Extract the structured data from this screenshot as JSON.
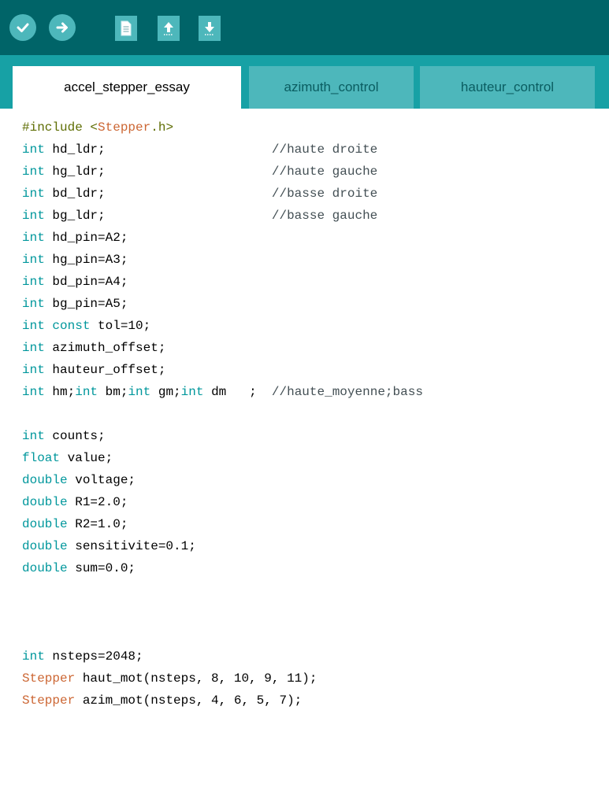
{
  "toolbar": {
    "buttons": [
      {
        "name": "verify",
        "icon": "checkmark-icon"
      },
      {
        "name": "upload",
        "icon": "arrow-right-icon"
      },
      {
        "name": "new",
        "icon": "new-file-icon"
      },
      {
        "name": "open",
        "icon": "open-upload-icon"
      },
      {
        "name": "save",
        "icon": "save-download-icon"
      }
    ]
  },
  "tabs": [
    {
      "label": "accel_stepper_essay",
      "active": true
    },
    {
      "label": "azimuth_control",
      "active": false
    },
    {
      "label": "hauteur_control",
      "active": false
    }
  ],
  "colors": {
    "toolbar_bg": "#006468",
    "tabbar_bg": "#17a1a5",
    "button_bg": "#4db7bb",
    "type_keyword": "#00979c",
    "class_keyword": "#cc6633"
  },
  "code": {
    "l1": {
      "a": "#include <",
      "b": "Stepper",
      "c": ".h>"
    },
    "l2": {
      "type": "int",
      "rest": " hd_ldr;                      ",
      "comment": "//haute droite"
    },
    "l3": {
      "type": "int",
      "rest": " hg_ldr;                      ",
      "comment": "//haute gauche"
    },
    "l4": {
      "type": "int",
      "rest": " bd_ldr;                      ",
      "comment": "//basse droite"
    },
    "l5": {
      "type": "int",
      "rest": " bg_ldr;                      ",
      "comment": "//basse gauche"
    },
    "l6": {
      "type": "int",
      "rest": " hd_pin=A2;"
    },
    "l7": {
      "type": "int",
      "rest": " hg_pin=A3;"
    },
    "l8": {
      "type": "int",
      "rest": " bd_pin=A4;"
    },
    "l9": {
      "type": "int",
      "rest": " bg_pin=A5;"
    },
    "l10": {
      "type": "int",
      "type2": " const",
      "rest": " tol=10;"
    },
    "l11": {
      "type": "int",
      "rest": " azimuth_offset;"
    },
    "l12": {
      "type": "int",
      "rest": " hauteur_offset;"
    },
    "l13": {
      "t1": "int",
      "r1": " hm;",
      "t2": "int",
      "r2": " bm;",
      "t3": "int",
      "r3": " gm;",
      "t4": "int",
      "r4": " dm   ;  ",
      "comment": "//haute_moyenne;bass"
    },
    "l15": {
      "type": "int",
      "rest": " counts;"
    },
    "l16": {
      "type": "float",
      "rest": " value;"
    },
    "l17": {
      "type": "double",
      "rest": " voltage;"
    },
    "l18": {
      "type": "double",
      "rest": " R1=2.0;"
    },
    "l19": {
      "type": "double",
      "rest": " R2=1.0;"
    },
    "l20": {
      "type": "double",
      "rest": " sensitivite=0.1;"
    },
    "l21": {
      "type": "double",
      "rest": " sum=0.0;"
    },
    "l25": {
      "type": "int",
      "rest": " nsteps=2048;"
    },
    "l26": {
      "cls": "Stepper",
      "rest": " haut_mot(nsteps, 8, 10, 9, 11);"
    },
    "l27": {
      "cls": "Stepper",
      "rest": " azim_mot(nsteps, 4, 6, 5, 7);"
    }
  }
}
